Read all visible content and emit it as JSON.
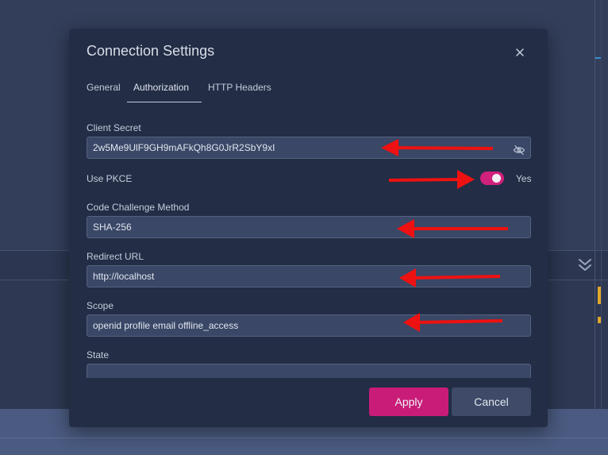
{
  "dialog": {
    "title": "Connection Settings",
    "close_icon": "close-icon"
  },
  "tabs": [
    {
      "label": "General",
      "active": false
    },
    {
      "label": "Authorization",
      "active": true
    },
    {
      "label": "HTTP Headers",
      "active": false
    }
  ],
  "fields": {
    "client_secret": {
      "label": "Client Secret",
      "value": "2w5Me9UlF9GH9mAFkQh8G0JrR2SbY9xI",
      "icon": "eye-off-icon"
    },
    "use_pkce": {
      "label": "Use PKCE",
      "enabled": true,
      "state_text": "Yes"
    },
    "code_challenge_method": {
      "label": "Code Challenge Method",
      "value": "SHA-256"
    },
    "redirect_url": {
      "label": "Redirect URL",
      "value": "http://localhost"
    },
    "scope": {
      "label": "Scope",
      "value": "openid profile email offline_access"
    },
    "state": {
      "label": "State",
      "value": ""
    }
  },
  "buttons": {
    "apply": "Apply",
    "cancel": "Cancel"
  },
  "colors": {
    "accent": "#c81c78",
    "annotation_arrow": "#ee1111",
    "dialog_bg": "#232d45"
  },
  "background": {
    "collapse_icon": "double-chevron-down-icon"
  }
}
